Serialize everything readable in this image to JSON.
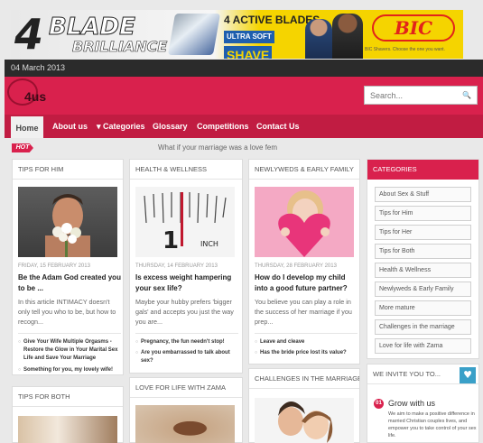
{
  "banner": {
    "number": "4",
    "blade": "BLADE",
    "brilliance": "BRILLIANCE",
    "active_blades": "4 ACTIVE BLADES",
    "ultra_soft": "ULTRA SOFT",
    "shave": "SHAVE",
    "brand": "BIC",
    "tagline": "BIC Shavers. Choose the one you want."
  },
  "date": "04 March 2013",
  "logo": {
    "text": "4us"
  },
  "search": {
    "placeholder": "Search..."
  },
  "nav": {
    "items": [
      {
        "label": "Home"
      },
      {
        "label": "About us"
      },
      {
        "label": "▾ Categories"
      },
      {
        "label": "Glossary"
      },
      {
        "label": "Competitions"
      },
      {
        "label": "Contact Us"
      }
    ]
  },
  "ticker": {
    "hot_label": "HOT",
    "text": "What if your marriage was a love fem"
  },
  "columns": [
    {
      "heading": "TIPS FOR HIM",
      "date": "FRIDAY, 15 FEBRUARY 2013",
      "title": "Be the Adam God created you to be ...",
      "excerpt": "In this article INTIMACY doesn't only tell you who to be, but how to recogn...",
      "related": [
        "Give Your Wife Multiple Orgasms - Restore the Glow in Your Marital Sex Life and Save Your Marriage",
        "Something for you, my lovely wife!"
      ]
    },
    {
      "heading": "HEALTH & WELLNESS",
      "date": "THURSDAY, 14 FEBRUARY 2013",
      "title": "Is excess weight hampering your sex life?",
      "excerpt": "Maybe your hubby prefers 'bigger gals' and accepts you just the way you are...",
      "related": [
        "Pregnancy, the fun needn't stop!",
        "Are you embarrassed to talk about sex?"
      ]
    },
    {
      "heading": "NEWLYWEDS & EARLY FAMILY",
      "date": "THURSDAY, 28 FEBRUARY 2013",
      "title": "How do I develop my child into a good future partner?",
      "excerpt": "You believe you can play a role in the success of her marriage if you prep...",
      "related": [
        "Leave and cleave",
        "Has the bride price lost its value?"
      ]
    }
  ],
  "lower_sections": {
    "tips_for_both": "TIPS FOR BOTH",
    "love_for_life": "LOVE FOR LIFE WITH ZAMA",
    "challenges": "CHALLENGES IN THE MARRIAGE"
  },
  "sidebar": {
    "heading": "CATEGORIES",
    "items": [
      "About Sex & Stuff",
      "Tips for Him",
      "Tips for Her",
      "Tips for Both",
      "Health & Wellness",
      "Newlyweds & Early Family",
      "More mature",
      "Challenges in the marriage",
      "Love for life with Zama"
    ],
    "invite_heading": "WE INVITE YOU TO...",
    "invite_number": "01",
    "invite_title": "Grow with us",
    "invite_text": "We aim to make a positive difference in married Christian couples lives, and empower you to take control of your sex life."
  },
  "colors": {
    "brand": "#d9214d",
    "nav": "#c11c42",
    "dark": "#2b2b2b",
    "invite": "#3aa0c8"
  }
}
